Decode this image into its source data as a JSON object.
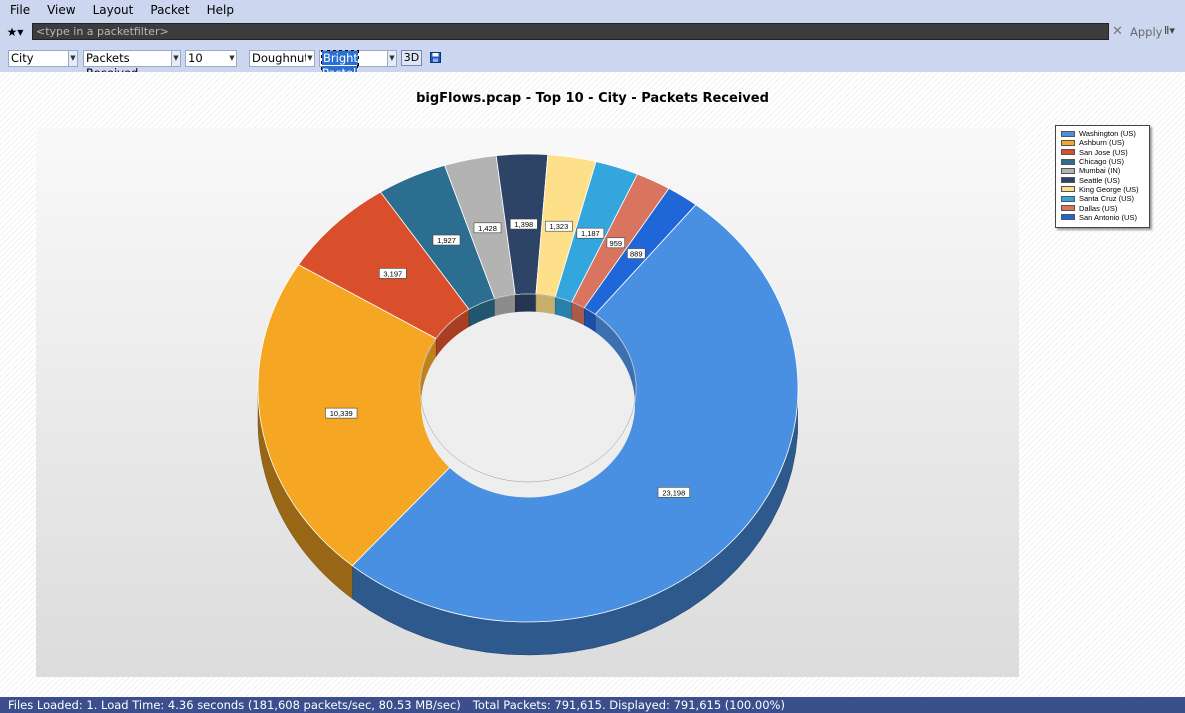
{
  "menu": {
    "items": [
      "File",
      "View",
      "Layout",
      "Packet",
      "Help"
    ]
  },
  "filter": {
    "star": "★▾",
    "placeholder": "<type in a packetfilter>",
    "clear": "✕",
    "apply": "Apply",
    "options": "Ⅱ▾"
  },
  "toolbar": {
    "field": "City",
    "metric": "Packets Received",
    "count": "10",
    "chart_type": "Doughnut",
    "palette": "Bright Pastel",
    "btn_3d": "3D",
    "colors": [
      "#4a90e2",
      "#f5a623",
      "#d94f2b",
      "#2c6e8f",
      "#b3b3b3",
      "#2d4466",
      "#ffe08a",
      "#32a6dd",
      "#d9745e",
      "#1f67d8"
    ]
  },
  "chart_data": {
    "type": "pie",
    "variant": "doughnut-3d",
    "title": "bigFlows.pcap - Top 10 - City - Packets Received",
    "categories": [
      "Washington (US)",
      "Ashburn (US)",
      "San Jose (US)",
      "Chicago (US)",
      "Mumbai (IN)",
      "Seattle (US)",
      "King George (US)",
      "Santa Cruz (US)",
      "Dallas (US)",
      "San Antonio (US)"
    ],
    "values": [
      23198,
      10339,
      3197,
      1927,
      1428,
      1398,
      1323,
      1187,
      959,
      889
    ],
    "labels": [
      "23,198",
      "10,339",
      "3,197",
      "1,927",
      "1,428",
      "1,398",
      "1,323",
      "1,187",
      "959",
      "889"
    ],
    "legend_position": "top-right"
  },
  "status": {
    "left": "Files Loaded: 1. Load Time: 4.36 seconds (181,608 packets/sec, 80.53 MB/sec)",
    "right": "Total Packets: 791,615. Displayed: 791,615 (100.00%)"
  }
}
